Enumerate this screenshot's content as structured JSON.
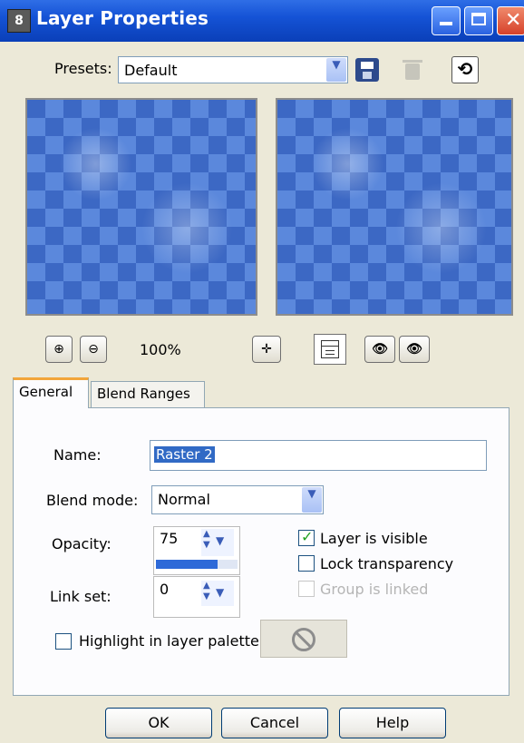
{
  "window": {
    "title": "Layer Properties",
    "app_icon_glyph": "8",
    "controls": [
      "minimize-icon",
      "maximize-icon",
      "close-icon"
    ]
  },
  "presets": {
    "label": "Presets:",
    "value": "Default",
    "icons": [
      "save-preset-icon",
      "delete-preset-icon",
      "reset-icon"
    ]
  },
  "preview": {
    "zoom_in_label": "⊕",
    "zoom_out_label": "⊖",
    "zoom_level": "100%",
    "pan_label": "✛"
  },
  "tabs": [
    {
      "label": "General",
      "active": true
    },
    {
      "label": "Blend Ranges",
      "active": false
    }
  ],
  "general": {
    "name_label": "Name:",
    "name_value": "Raster 2",
    "blend_mode_label": "Blend mode:",
    "blend_mode_value": "Normal",
    "opacity_label": "Opacity:",
    "opacity_value": "75",
    "opacity_fraction": 0.75,
    "link_set_label": "Link set:",
    "link_set_value": "0",
    "layer_visible_label": "Layer is visible",
    "layer_visible_checked": true,
    "lock_transparency_label": "Lock transparency",
    "lock_transparency_checked": false,
    "group_linked_label": "Group is linked",
    "group_linked_enabled": false,
    "highlight_label": "Highlight in layer palette:",
    "highlight_checked": false
  },
  "buttons": {
    "ok": "OK",
    "cancel": "Cancel",
    "help": "Help"
  },
  "colors": {
    "title_bar": "#1553d6",
    "tab_accent": "#f2a53b",
    "opacity_bar": "#2e6ad8",
    "check_tick": "#21a121"
  }
}
